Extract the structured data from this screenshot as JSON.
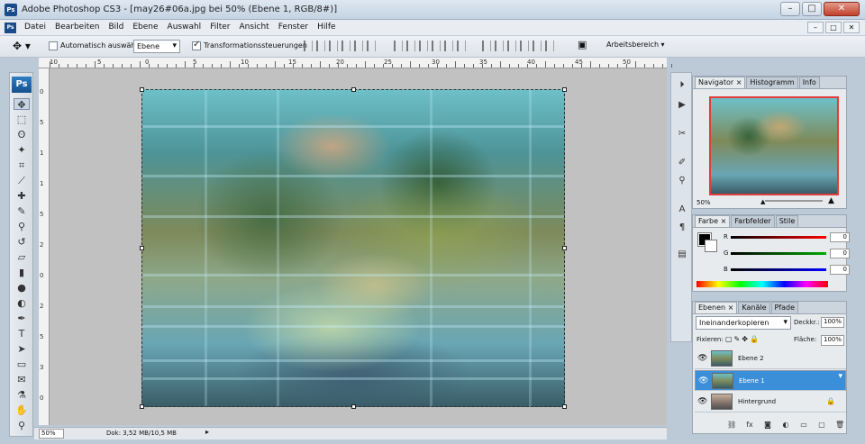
{
  "window": {
    "title": "Adobe Photoshop CS3 - [may26#06a.jpg bei 50% (Ebene 1, RGB/8#)]",
    "app_badge": "Ps",
    "minimize": "–",
    "restore": "□",
    "close": "✕"
  },
  "menu": [
    "Datei",
    "Bearbeiten",
    "Bild",
    "Ebene",
    "Auswahl",
    "Filter",
    "Ansicht",
    "Fenster",
    "Hilfe"
  ],
  "options_bar": {
    "auto_select_label": "Automatisch auswählen:",
    "auto_select_value": "Ebene",
    "transform_label": "Transformationssteuerungen",
    "workspace_label": "Arbeitsbereich ▾"
  },
  "ruler": {
    "h_labels": [
      "10",
      "5",
      "0",
      "5",
      "10",
      "15",
      "20",
      "25",
      "30",
      "35",
      "40",
      "45",
      "50"
    ],
    "v_labels": [
      "0",
      "5",
      "1",
      "1",
      "5",
      "2",
      "0",
      "2",
      "5",
      "3",
      "0"
    ]
  },
  "toolbox": {
    "logo": "Ps",
    "tools": [
      {
        "name": "move-tool",
        "glyph": "✥"
      },
      {
        "name": "marquee-tool",
        "glyph": "⬚"
      },
      {
        "name": "lasso-tool",
        "glyph": "ʘ"
      },
      {
        "name": "magic-wand-tool",
        "glyph": "✦"
      },
      {
        "name": "crop-tool",
        "glyph": "⌗"
      },
      {
        "name": "slice-tool",
        "glyph": "⟋"
      },
      {
        "name": "healing-brush-tool",
        "glyph": "✚"
      },
      {
        "name": "brush-tool",
        "glyph": "✎"
      },
      {
        "name": "stamp-tool",
        "glyph": "⚲"
      },
      {
        "name": "history-brush-tool",
        "glyph": "↺"
      },
      {
        "name": "eraser-tool",
        "glyph": "▱"
      },
      {
        "name": "gradient-tool",
        "glyph": "▮"
      },
      {
        "name": "blur-tool",
        "glyph": "●"
      },
      {
        "name": "dodge-tool",
        "glyph": "◐"
      },
      {
        "name": "pen-tool",
        "glyph": "✒"
      },
      {
        "name": "type-tool",
        "glyph": "T"
      },
      {
        "name": "path-selection-tool",
        "glyph": "➤"
      },
      {
        "name": "shape-tool",
        "glyph": "▭"
      },
      {
        "name": "notes-tool",
        "glyph": "✉"
      },
      {
        "name": "eyedropper-tool",
        "glyph": "⚗"
      },
      {
        "name": "hand-tool",
        "glyph": "✋"
      },
      {
        "name": "zoom-tool",
        "glyph": "⚲"
      }
    ]
  },
  "status": {
    "zoom": "50%",
    "doc_info": "Dok: 3,52 MB/10,5 MB",
    "arrow": "▸"
  },
  "navigator": {
    "tabs": [
      "Navigator ×",
      "Histogramm",
      "Info"
    ],
    "zoom": "50%"
  },
  "color": {
    "tabs": [
      "Farbe ×",
      "Farbfelder",
      "Stile"
    ],
    "channels": [
      {
        "label": "R",
        "value": "0",
        "gradient": "linear-gradient(90deg,#000,#f00)"
      },
      {
        "label": "G",
        "value": "0",
        "gradient": "linear-gradient(90deg,#000,#0a0)"
      },
      {
        "label": "B",
        "value": "0",
        "gradient": "linear-gradient(90deg,#000,#00f)"
      }
    ]
  },
  "layers": {
    "tabs": [
      "Ebenen ×",
      "Kanäle",
      "Pfade"
    ],
    "blend_mode": "Ineinanderkopieren",
    "opacity_label": "Deckkr.:",
    "opacity_value": "100%",
    "lock_label": "Fixieren:",
    "fill_label": "Fläche:",
    "fill_value": "100%",
    "items": [
      {
        "name": "Ebene 2",
        "selected": false,
        "locked": false
      },
      {
        "name": "Ebene 1",
        "selected": true,
        "locked": false
      },
      {
        "name": "Hintergrund",
        "selected": false,
        "locked": true
      }
    ],
    "bottom_icons": [
      "⛓",
      "fx",
      "◙",
      "◐",
      "▭",
      "▢",
      "🗑"
    ]
  },
  "colors": {
    "selection_blue": "#3b8fd9",
    "navigator_frame": "#e03c3c"
  }
}
